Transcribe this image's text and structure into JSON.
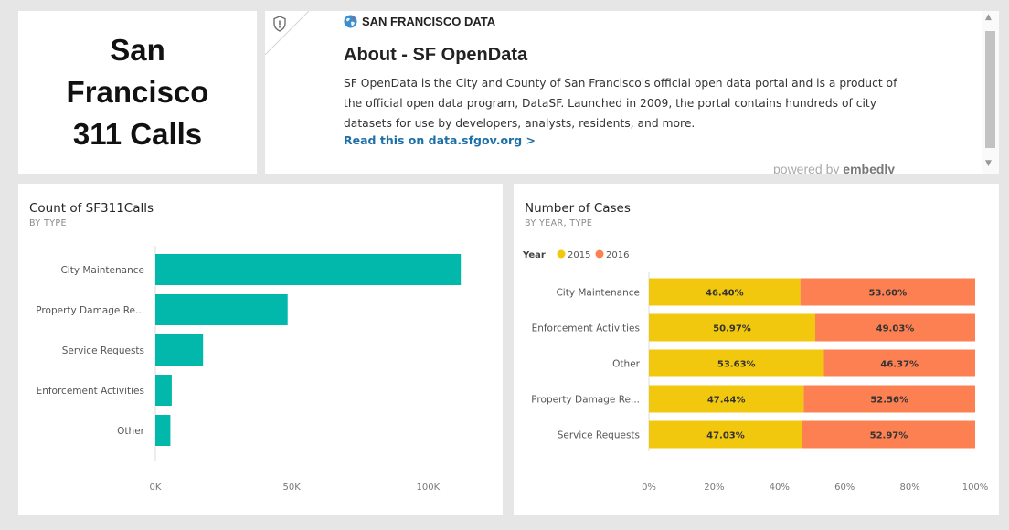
{
  "title_tile": {
    "lines": [
      "San",
      "Francisco",
      "311 Calls"
    ]
  },
  "about": {
    "source": "SAN FRANCISCO DATA",
    "heading": "About - SF OpenData",
    "body": "SF OpenData is the City and County of San Francisco's official open data portal and is a product of the official open data program, DataSF. Launched in 2009, the portal contains hundreds of city datasets for use by developers, analysts, residents, and more.",
    "link": "Read this on data.sfgov.org >",
    "powered_by_prefix": "powered by",
    "powered_by_brand": "embedly"
  },
  "colors": {
    "teal": "#01b8aa",
    "year_2015": "#f2c80f",
    "year_2016": "#fd8052",
    "link": "#1d6fa8"
  },
  "chart_data": [
    {
      "type": "bar",
      "orientation": "horizontal",
      "title": "Count of SF311Calls",
      "subtitle": "BY TYPE",
      "categories": [
        "City Maintenance",
        "Property Damage Re...",
        "Service Requests",
        "Enforcement Activities",
        "Other"
      ],
      "values": [
        112000,
        48500,
        17500,
        6000,
        5500
      ],
      "xlim": [
        0,
        124000
      ],
      "xticks": [
        0,
        50000,
        100000
      ],
      "xtick_labels": [
        "0K",
        "50K",
        "100K"
      ],
      "grid": false
    },
    {
      "type": "bar",
      "orientation": "horizontal",
      "stacked": "100%",
      "title": "Number of Cases",
      "subtitle": "BY YEAR, TYPE",
      "legend_title": "Year",
      "legend_position": "top-left",
      "categories": [
        "City Maintenance",
        "Enforcement Activities",
        "Other",
        "Property Damage Re...",
        "Service Requests"
      ],
      "series": [
        {
          "name": "2015",
          "values": [
            46.4,
            50.97,
            53.63,
            47.44,
            47.03
          ],
          "labels": [
            "46.40%",
            "50.97%",
            "53.63%",
            "47.44%",
            "47.03%"
          ]
        },
        {
          "name": "2016",
          "values": [
            53.6,
            49.03,
            46.37,
            52.56,
            52.97
          ],
          "labels": [
            "53.60%",
            "49.03%",
            "46.37%",
            "52.56%",
            "52.97%"
          ]
        }
      ],
      "xlim": [
        0,
        100
      ],
      "xticks": [
        0,
        20,
        40,
        60,
        80,
        100
      ],
      "xtick_labels": [
        "0%",
        "20%",
        "40%",
        "60%",
        "80%",
        "100%"
      ],
      "grid": false
    }
  ]
}
